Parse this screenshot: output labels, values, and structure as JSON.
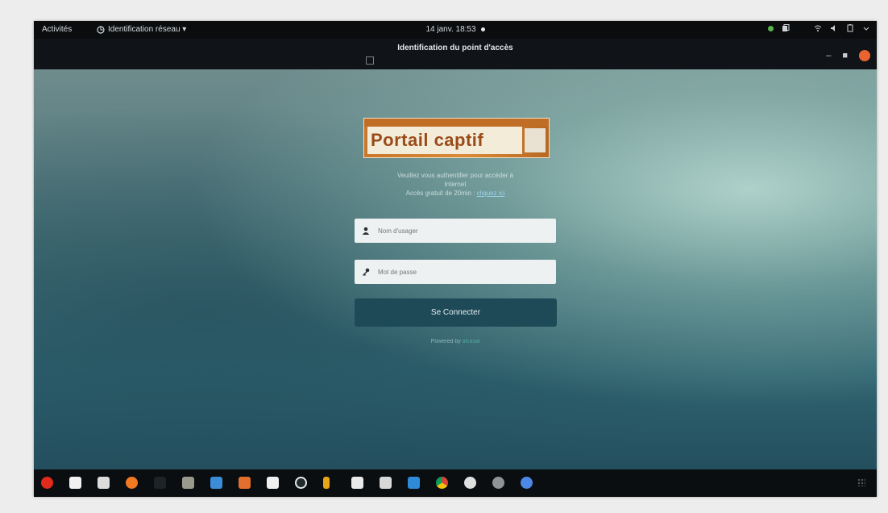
{
  "topbar": {
    "activities": "Activités",
    "network_menu": "Identification réseau ▾",
    "clock": "14 janv. 18:53"
  },
  "window": {
    "title": "Identification du point d'accès"
  },
  "portal": {
    "logo_text": "Portail captif",
    "intro_line1": "Veuillez vous authentifier pour accéder à",
    "intro_line2": "Internet",
    "intro_line3": "Accès gratuit de 20min :",
    "intro_link": "cliquez ici",
    "username_placeholder": "Nom d'usager",
    "password_placeholder": "Mot de passe",
    "connect_label": "Se Connecter",
    "powered_by": "Powered by",
    "powered_link": "alcasar"
  },
  "colors": {
    "accent_button": "#1e4a58",
    "close_button": "#e9642e",
    "logo_orange": "#d98c38"
  },
  "dock": {
    "apps": [
      "opera-icon",
      "files-icon",
      "text-editor-icon",
      "firefox-icon",
      "terminal-icon",
      "settings-icon",
      "calendar-icon",
      "store-icon",
      "document-icon",
      "whatsapp-icon",
      "thunder-icon",
      "notes-icon",
      "mail-icon",
      "vscode-icon",
      "chrome-icon",
      "steam-icon",
      "disk-icon",
      "chromium-icon"
    ]
  }
}
